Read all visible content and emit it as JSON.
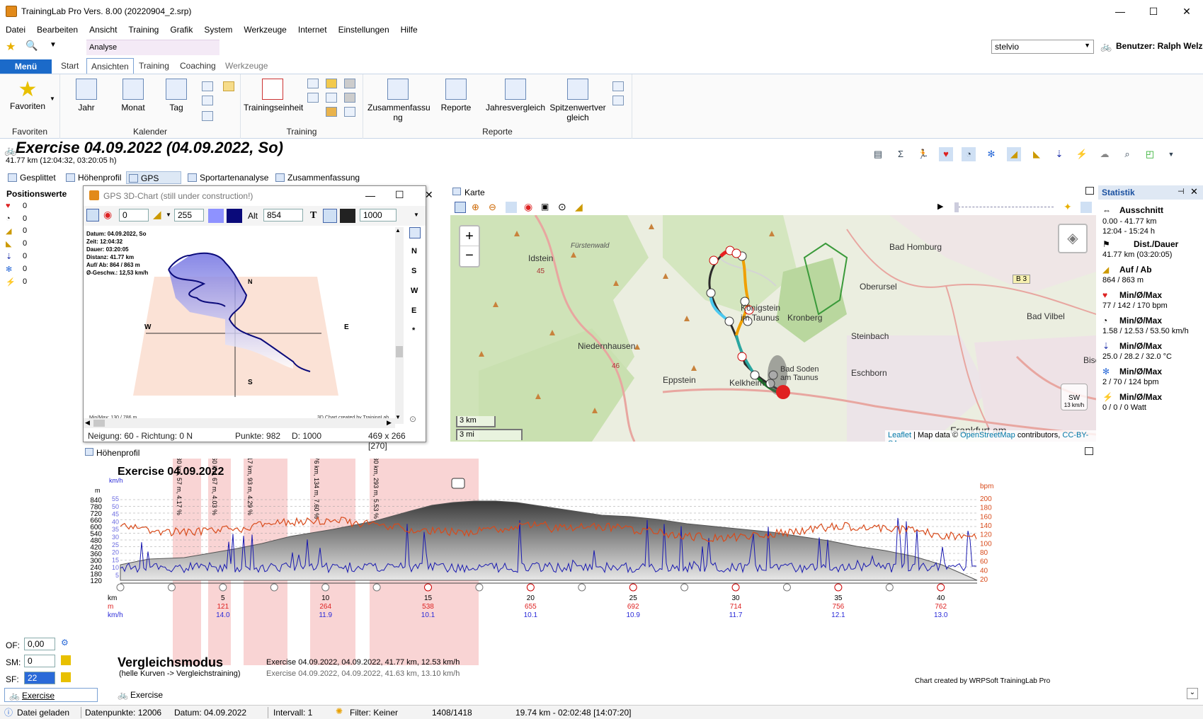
{
  "app": {
    "title": "TrainingLab Pro Vers. 8.00 (20220904_2.srp)"
  },
  "menubar": [
    "Datei",
    "Bearbeiten",
    "Ansicht",
    "Training",
    "Grafik",
    "System",
    "Werkzeuge",
    "Internet",
    "Einstellungen",
    "Hilfe"
  ],
  "ribbon": {
    "context_label": "Analyse",
    "menu_label": "Menü",
    "tabs": [
      "Start",
      "Ansichten",
      "Training",
      "Coaching",
      "Werkzeuge"
    ],
    "groups": {
      "favoriten": {
        "label": "Favoriten",
        "button": "Favoriten"
      },
      "kalender": {
        "label": "Kalender",
        "buttons": [
          "Jahr",
          "Monat",
          "Tag"
        ]
      },
      "training": {
        "label": "Training",
        "button": "Trainingseinheit"
      },
      "reporte": {
        "label": "Reporte",
        "buttons": [
          "Zusammenfassu ng",
          "Reporte",
          "Jahresvergleich",
          "Spitzenwertver gleich"
        ]
      }
    },
    "user_select": "stelvio",
    "user_label": "Benutzer: Ralph Welz"
  },
  "exercise": {
    "title": "Exercise 04.09.2022 (04.09.2022, So)",
    "subtitle": "41.77 km (12:04:32, 03:20:05 h)"
  },
  "subtabs": [
    "Gesplittet",
    "Höhenprofil",
    "GPS Karte",
    "Sportartenanalyse",
    "Zusammenfassung"
  ],
  "positionswerte": {
    "title": "Positionswerte",
    "values": [
      "0",
      "0",
      "0",
      "0",
      "0",
      "0",
      "0"
    ]
  },
  "popup": {
    "title": "GPS 3D-Chart (still under construction!)",
    "toolbar": {
      "v1": "0",
      "v2": "255",
      "alt_label": "Alt",
      "alt": "854",
      "t_label": "T",
      "v3": "1000"
    },
    "info": [
      "Datum: 04.09.2022, So",
      "Zeit: 12:04:32",
      "Dauer: 03:20:05",
      "Distanz: 41.77 km",
      "Auf/ Ab: 864 / 863 m",
      "Ø-Geschw.: 12,53 km/h"
    ],
    "directions": [
      "N",
      "S",
      "W",
      "E",
      "*"
    ],
    "axis": {
      "n": "N",
      "s": "S",
      "w": "W",
      "e": "E"
    },
    "minmax": "Min/Max: 130 / 786 m",
    "credit": "3D Chart created by TrainingLab Pro",
    "footer": {
      "neigung": "Neigung: 60 - Richtung: 0 N",
      "punkte": "Punkte: 982",
      "d": "D: 1000",
      "size": "469 x 266 [270]"
    }
  },
  "map": {
    "header": "Karte",
    "zoom_in": "+",
    "zoom_out": "−",
    "scale_km": "3 km",
    "scale_mi": "3 mi",
    "compass": "SW",
    "compass_speed": "13 km/h",
    "attribution": {
      "leaflet": "Leaflet",
      "data": "| Map data ©",
      "osm": "OpenStreetMap",
      "contrib": "contributors,",
      "lic": "CC-BY-SA"
    },
    "places": [
      "Idstein",
      "Fürstenwald",
      "Bad Homburg",
      "Oberursel",
      "Kronberg",
      "Königstein im Taunus",
      "Steinbach",
      "Bad Vilbel",
      "Niedernhausen",
      "Eppstein",
      "Kelkheim",
      "Bad Soden am Taunus",
      "Eschborn",
      "Frankfurt am",
      "Bisc"
    ],
    "roads": [
      "B 3",
      "45",
      "46"
    ]
  },
  "statistik": {
    "title": "Statistik",
    "items": [
      {
        "label": "Ausschnitt",
        "value": "0.00 - 41.77 km\n12:04 - 15:24 h"
      },
      {
        "label": "Dist./Dauer",
        "value": "41.77 km (03:20:05)"
      },
      {
        "label": "Auf / Ab",
        "value": "864 / 863 m"
      },
      {
        "label": "Min/Ø/Max",
        "value": "77 / 142 / 170 bpm"
      },
      {
        "label": "Min/Ø/Max",
        "value": "1.58 / 12.53 / 53.50 km/h"
      },
      {
        "label": "Min/Ø/Max",
        "value": "25.0 / 28.2 / 32.0 °C"
      },
      {
        "label": "Min/Ø/Max",
        "value": "2 / 70 / 124 bpm"
      },
      {
        "label": "Min/Ø/Max",
        "value": "0 / 0 / 0 Watt"
      }
    ]
  },
  "elevation": {
    "header": "Höhenprofil",
    "chart_title": "Exercise 04.09.2022",
    "left_axis_m": [
      "840",
      "780",
      "720",
      "660",
      "600",
      "540",
      "480",
      "420",
      "360",
      "300",
      "240",
      "180",
      "120"
    ],
    "left_axis_kmh": [
      "55",
      "50",
      "45",
      "40",
      "35",
      "30",
      "25",
      "20",
      "15",
      "10",
      "5"
    ],
    "left_unit_m": "m",
    "left_unit_kmh": "km/h",
    "right_unit": "bpm",
    "right_axis": [
      "200",
      "180",
      "160",
      "140",
      "120",
      "100",
      "80",
      "60",
      "40",
      "20"
    ],
    "x_ticks": [
      {
        "km": "5",
        "m": "121",
        "kmh": "14.0"
      },
      {
        "km": "10",
        "m": "264",
        "kmh": "11.9"
      },
      {
        "km": "15",
        "m": "538",
        "kmh": "10.1"
      },
      {
        "km": "20",
        "m": "655",
        "kmh": "10.1"
      },
      {
        "km": "25",
        "m": "692",
        "kmh": "10.9"
      },
      {
        "km": "30",
        "m": "714",
        "kmh": "11.7"
      },
      {
        "km": "35",
        "m": "756",
        "kmh": "12.1"
      },
      {
        "km": "40",
        "m": "762",
        "kmh": "13.0"
      }
    ],
    "x_labels": {
      "km": "km",
      "m": "m",
      "kmh": "km/h"
    },
    "climbs": [
      "1.30 km, 57 m, 4.17 %",
      "1.60 km, 67 m, 4.03 %",
      "2.17 km, 93 m, 4.29 %",
      "1.76 km, 134 m, 7.60 %",
      "5.30 km, 293 m, 5.53 %"
    ],
    "compare_title": "Vergleichsmodus",
    "compare_sub": "(helle Kurven -> Vergleichstraining)",
    "compare_lines": [
      "Exercise 04.09.2022,   04.09.2022, 41.77 km, 12.53 km/h",
      "Exercise 04.09.2022,   04.09.2022, 41.63 km, 13.10 km/h"
    ],
    "credit": "Chart created by WRPSoft TrainingLab Pro",
    "colors": {
      "elev": "#555555",
      "speed": "#1a1ab0",
      "hr": "#d84a1a",
      "climb": "#f7c9c9"
    }
  },
  "controls": {
    "of_label": "OF:",
    "of_value": "0,00",
    "sm_label": "SM:",
    "sm_value": "0",
    "sf_label": "SF:",
    "sf_value": "22"
  },
  "bottom_tabs": [
    "Exercise 04.09.2022",
    "Exercise 04.09.2022"
  ],
  "status": {
    "loaded": "Datei geladen",
    "datenpunkte": "Datenpunkte: 12006",
    "datum": "Datum: 04.09.2022",
    "intervall": "Intervall: 1",
    "filter": "Filter: Keiner",
    "count": "1408/1418",
    "pos": "19.74 km - 02:02:48 [14:07:20]"
  }
}
